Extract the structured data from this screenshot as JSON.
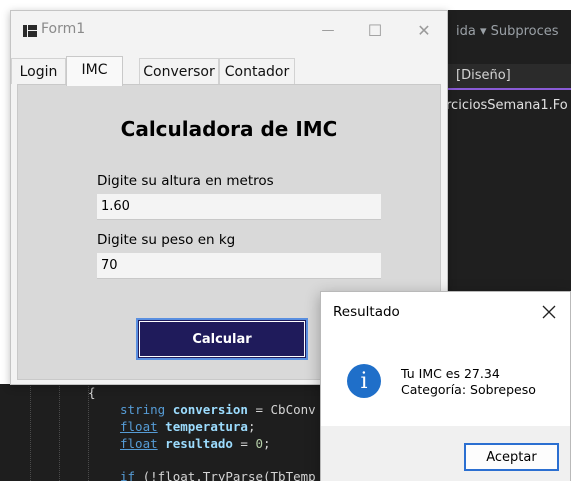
{
  "window": {
    "title": "Form1",
    "minimize_glyph": "—",
    "maximize_glyph": "☐",
    "close_glyph": "✕"
  },
  "tabs": [
    {
      "label": "Login",
      "active": false
    },
    {
      "label": "IMC",
      "active": true
    },
    {
      "label": "Conversor",
      "active": false
    },
    {
      "label": "Contador",
      "active": false
    }
  ],
  "imc": {
    "heading": "Calculadora de IMC",
    "height_label": "Digite su altura en metros",
    "height_value": "1.60",
    "weight_label": "Digite su peso en kg",
    "weight_value": "70",
    "calculate_label": "Calcular"
  },
  "dialog": {
    "title": "Resultado",
    "line1": "Tu IMC es 27.34",
    "line2": "Categoría: Sobrepeso",
    "icon_glyph": "i",
    "ok_label": "Aceptar"
  },
  "editor": {
    "menu_text": "ida ▾ Subproces",
    "tab_text": "[Diseño]",
    "file_text": "rciciosSemana1.Fo",
    "code": {
      "brace": "{",
      "l1_type": "string",
      "l1_var": "conversion",
      "l1_rest": " = CbConv",
      "l2_type": "float",
      "l2_var": "temperatura",
      "l2_rest": ";",
      "l3_type": "float",
      "l3_var": "resultado",
      "l3_eq": " = ",
      "l3_num": "0",
      "l3_rest": ";",
      "l4_kw": "if",
      "l4_rest": " (!float.TryParse(TbTemp"
    }
  },
  "colors": {
    "button_primary": "#1f1b5b",
    "accent_border": "#5a8fe0",
    "info_icon": "#1f6fc9",
    "editor_bg": "#1e1e1e"
  }
}
